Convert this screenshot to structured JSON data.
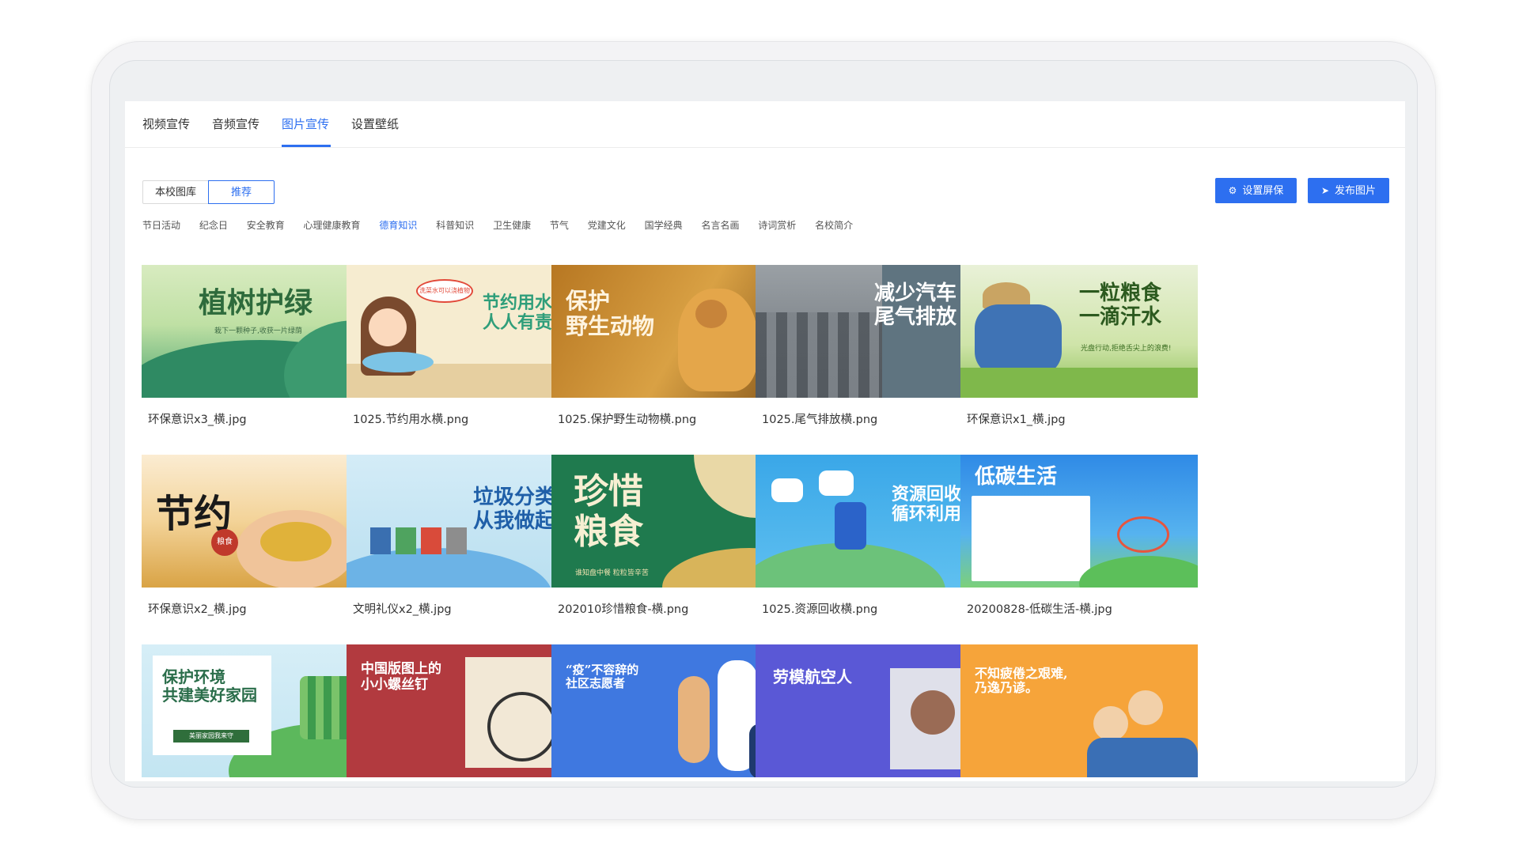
{
  "tabs": [
    {
      "label": "视频宣传"
    },
    {
      "label": "音频宣传"
    },
    {
      "label": "图片宣传"
    },
    {
      "label": "设置壁纸"
    }
  ],
  "active_tab": "图片宣传",
  "library": {
    "school_label": "本校图库",
    "recommend_label": "推荐"
  },
  "actions": {
    "set_screensaver": "设置屏保",
    "publish_image": "发布图片"
  },
  "categories": [
    {
      "label": "节日活动"
    },
    {
      "label": "纪念日"
    },
    {
      "label": "安全教育"
    },
    {
      "label": "心理健康教育"
    },
    {
      "label": "德育知识"
    },
    {
      "label": "科普知识"
    },
    {
      "label": "卫生健康"
    },
    {
      "label": "节气"
    },
    {
      "label": "党建文化"
    },
    {
      "label": "国学经典"
    },
    {
      "label": "名言名画"
    },
    {
      "label": "诗词赏析"
    },
    {
      "label": "名校简介"
    }
  ],
  "active_category": "德育知识",
  "colors": {
    "accent": "#2d6ff0"
  },
  "images": [
    {
      "filename": "环保意识x3_横.jpg",
      "title": "植树护绿",
      "subtitle": "栽下一颗种子,收获一片绿荫"
    },
    {
      "filename": "1025.节约用水横.png",
      "title": "节约用水\n人人有责",
      "subtitle": "洗菜水可以浇植物"
    },
    {
      "filename": "1025.保护野生动物横.png",
      "title": "保护\n野生动物",
      "subtitle": ""
    },
    {
      "filename": "1025.尾气排放横.png",
      "title": "减少汽车\n尾气排放",
      "subtitle": ""
    },
    {
      "filename": "环保意识x1_横.jpg",
      "title": "一粒粮食\n一滴汗水",
      "subtitle": "光盘行动,拒绝舌尖上的浪费!"
    },
    {
      "filename": "环保意识x2_横.jpg",
      "title": "节约",
      "subtitle": "粮食"
    },
    {
      "filename": "文明礼仪x2_横.jpg",
      "title": "垃圾分类\n从我做起",
      "subtitle": ""
    },
    {
      "filename": "202010珍惜粮食-横.png",
      "title": "珍惜\n粮食",
      "subtitle": "谁知盘中餐 粒粒皆辛苦"
    },
    {
      "filename": "1025.资源回收横.png",
      "title": "资源回收\n循环利用",
      "subtitle": ""
    },
    {
      "filename": "20200828-低碳生活-横.jpg",
      "title": "低碳生活",
      "subtitle": ""
    },
    {
      "filename": "",
      "title": "保护环境\n共建美好家园",
      "subtitle": "美丽家园我来守"
    },
    {
      "filename": "",
      "title": "中国版图上的\n小小螺丝钉",
      "subtitle": ""
    },
    {
      "filename": "",
      "title": "“疫”不容辞的\n社区志愿者",
      "subtitle": ""
    },
    {
      "filename": "",
      "title": "劳模航空人",
      "subtitle": ""
    },
    {
      "filename": "",
      "title": "不知疲倦之艰难,\n乃逸乃谚。",
      "subtitle": ""
    }
  ]
}
